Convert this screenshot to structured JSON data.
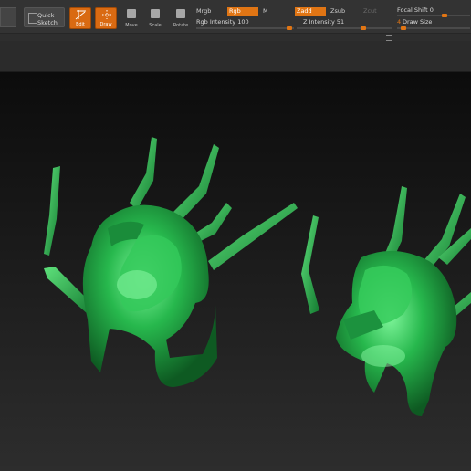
{
  "toolbar": {
    "quick_sketch": "Quick\nSketch",
    "edit": "Edit",
    "draw": "Draw",
    "move": "Move",
    "scale": "Scale",
    "rotate": "Rotate",
    "mrgb": "Mrgb",
    "rgb": "Rgb",
    "m": "M",
    "rgb_intensity": "Rgb Intensity 100",
    "zadd": "Zadd",
    "zsub": "Zsub",
    "zcut": "Zcut",
    "z_intensity": "Z Intensity 51",
    "focal_shift": "Focal Shift 0",
    "draw_size_num": "4",
    "draw_size": "Draw Size"
  },
  "values": {
    "rgb_intensity": 100,
    "z_intensity": 51,
    "focal_shift": 0,
    "draw_size": 4
  },
  "colors": {
    "accent": "#e07514",
    "model": "#22b24a"
  },
  "icons": [
    "quick-sketch-icon",
    "edit-icon",
    "draw-icon",
    "move-icon",
    "scale-icon",
    "rotate-icon"
  ]
}
